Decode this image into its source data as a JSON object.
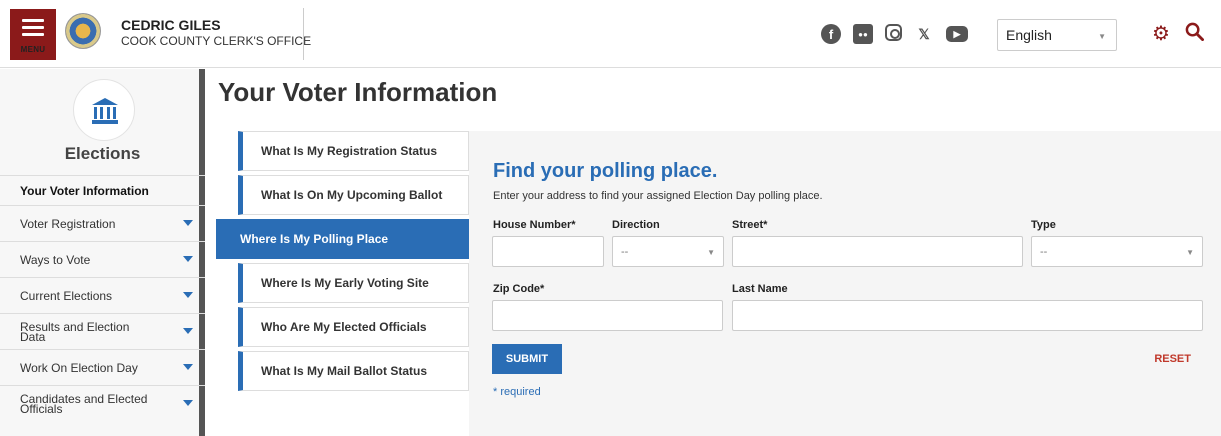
{
  "header": {
    "menu_label": "MENU",
    "brand_name": "CEDRIC GILES",
    "brand_office": "COOK COUNTY CLERK'S OFFICE",
    "language": "English",
    "social_icons": [
      "facebook-icon",
      "flickr-icon",
      "instagram-icon",
      "x-icon",
      "youtube-icon"
    ]
  },
  "sidebar": {
    "title": "Elections",
    "items": [
      {
        "label": "Your Voter Information",
        "active": true
      },
      {
        "label": "Voter Registration"
      },
      {
        "label": "Ways to Vote"
      },
      {
        "label": "Current Elections"
      },
      {
        "label": "Results and Election Data"
      },
      {
        "label": "Work On Election Day"
      },
      {
        "label": "Candidates and Elected Officials"
      }
    ]
  },
  "main": {
    "title": "Your Voter Information",
    "tabs": [
      "What Is My Registration Status",
      "What Is On My Upcoming Ballot",
      "Where Is My Polling Place",
      "Where Is My Early Voting Site",
      "Who Are My Elected Officials",
      "What Is My Mail Ballot Status"
    ],
    "active_tab": "Where Is My Polling Place"
  },
  "form": {
    "heading": "Find your polling place.",
    "intro": "Enter your address to find your assigned Election Day polling place.",
    "house_number_label": "House Number*",
    "direction_label": "Direction",
    "direction_value": "--",
    "street_label": "Street*",
    "type_label": "Type",
    "type_value": "--",
    "zip_label": "Zip Code*",
    "last_name_label": "Last Name",
    "submit": "SUBMIT",
    "reset": "RESET",
    "required_note": "* required"
  },
  "colors": {
    "brand_red": "#8b1a1a",
    "accent_blue": "#2a6db5",
    "reset_red": "#c0392b"
  }
}
